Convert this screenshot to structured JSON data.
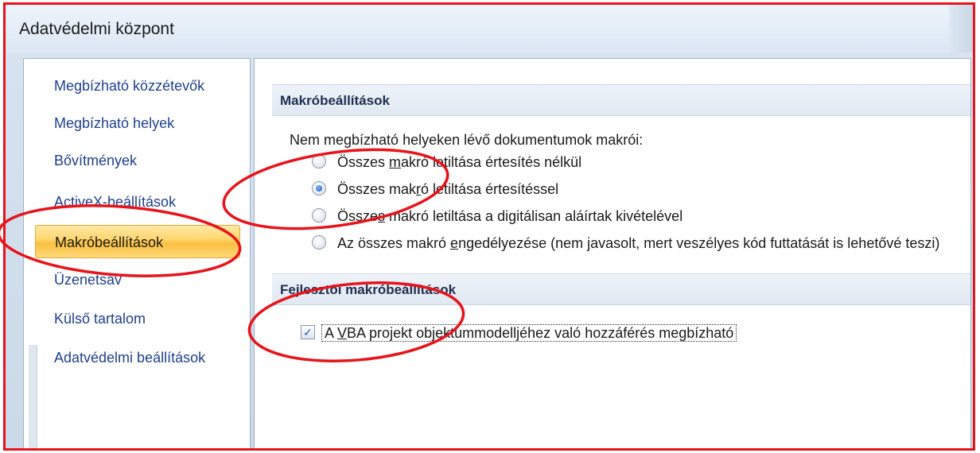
{
  "window": {
    "title": "Adatvédelmi központ"
  },
  "sidebar": {
    "items": [
      {
        "label": "Megbízható közzétevők",
        "active": false
      },
      {
        "label": "Megbízható helyek",
        "active": false
      },
      {
        "label": "Bővítmények",
        "active": false
      },
      {
        "label": "ActiveX-beállítások",
        "active": false
      },
      {
        "label": "Makróbeállítások",
        "active": true
      },
      {
        "label": "Üzenetsáv",
        "active": false
      },
      {
        "label": "Külső tartalom",
        "active": false
      },
      {
        "label": "Adatvédelmi beállítások",
        "active": false
      }
    ]
  },
  "macro_settings": {
    "heading": "Makróbeállítások",
    "prompt": "Nem megbízható helyeken lévő dokumentumok makrói:",
    "options": [
      {
        "pre": "Összes ",
        "key": "m",
        "post": "akró letiltása értesítés nélkül",
        "checked": false
      },
      {
        "pre": "Összes mak",
        "key": "r",
        "post": "ó letiltása értesítéssel",
        "checked": true
      },
      {
        "pre": "Össze",
        "key": "s",
        "post": " makró letiltása a digitálisan aláírtak kivételével",
        "checked": false
      },
      {
        "pre": "Az összes makró ",
        "key": "e",
        "post": "ngedélyezése (nem javasolt, mert veszélyes kód futtatását is lehetővé teszi)",
        "checked": false
      }
    ]
  },
  "developer_settings": {
    "heading": "Fejlesztői makróbeállítások",
    "checkbox": {
      "pre": "A ",
      "key": "V",
      "post": "BA projekt objektummodelljéhez való hozzáférés megbízható",
      "checked": true,
      "mark": "✓"
    }
  },
  "colors": {
    "annotation_red": "#e8131b",
    "nav_text": "#1f3f8c",
    "active_gold": "#fbbf3f"
  }
}
